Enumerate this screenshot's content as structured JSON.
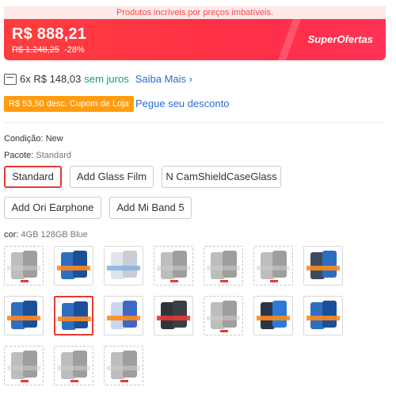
{
  "promo": {
    "text": "Produtos incríveis por preços imbatíveis."
  },
  "price": {
    "current": "R$ 888,21",
    "original": "R$ 1.248,25",
    "discount": "-28%",
    "badge": "SuperOfertas"
  },
  "installment": {
    "count": "6x R$ 148,03",
    "interest": "sem juros",
    "link": "Saiba Mais"
  },
  "coupon": {
    "label": "R$ 53,50 desc. Cupom de Loja",
    "link": "Pegue seu desconto"
  },
  "condition": {
    "label": "Condição:",
    "value": "New"
  },
  "package": {
    "label": "Pacote:",
    "value": "Standard",
    "options": [
      "Standard",
      "Add Glass Film",
      "N CamShieldCaseGlass",
      "Add Ori Earphone",
      "Add Mi Band 5"
    ],
    "selected": "Standard"
  },
  "color": {
    "label": "cor:",
    "value": "4GB 128GB Blue",
    "swatches": [
      {
        "style": "gray",
        "available": false
      },
      {
        "style": "blue",
        "available": true
      },
      {
        "style": "silver",
        "available": true
      },
      {
        "style": "gray",
        "available": false
      },
      {
        "style": "gray",
        "available": false
      },
      {
        "style": "gray",
        "available": false
      },
      {
        "style": "dark",
        "available": true
      },
      {
        "style": "blue",
        "available": true
      },
      {
        "style": "blue",
        "available": true,
        "selected": true
      },
      {
        "style": "silver-blue",
        "available": true
      },
      {
        "style": "dark-red",
        "available": true
      },
      {
        "style": "gray",
        "available": false
      },
      {
        "style": "dark-blue",
        "available": true
      },
      {
        "style": "blue",
        "available": true
      },
      {
        "style": "gray",
        "available": false
      },
      {
        "style": "gray",
        "available": false
      },
      {
        "style": "gray",
        "available": false
      }
    ]
  },
  "colors": {
    "accent": "#ff4747",
    "selected_border": "#e53935",
    "link": "#2a6cd5",
    "green": "#16a05d",
    "coupon": "#ff9c0f"
  }
}
